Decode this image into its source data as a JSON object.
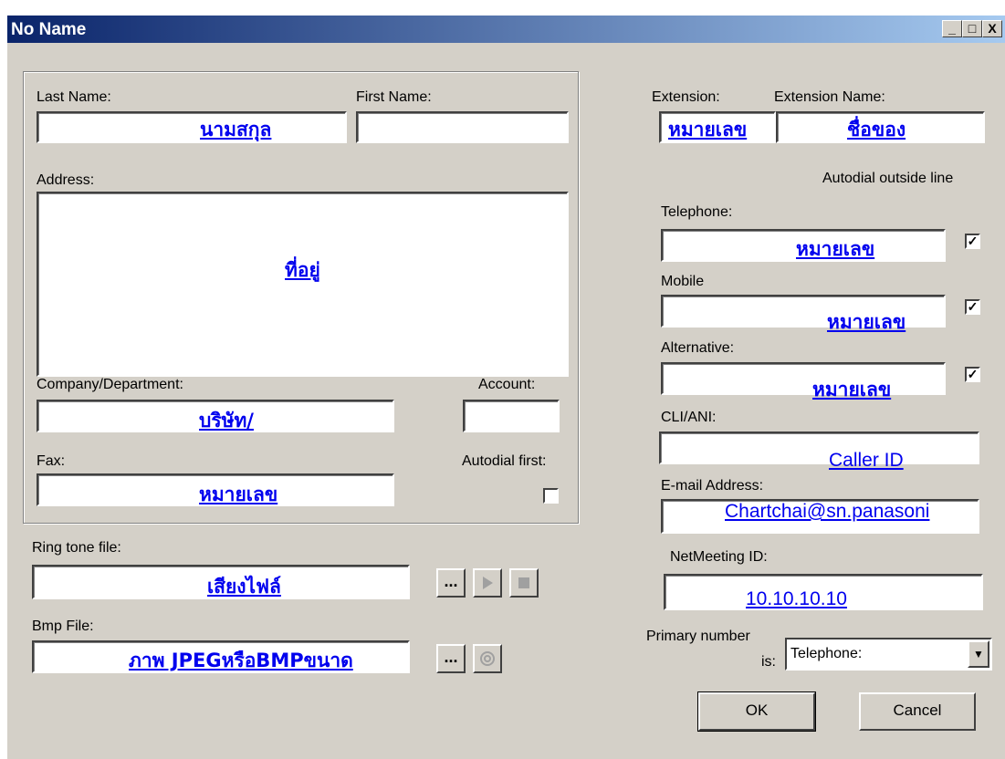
{
  "window": {
    "title": "No Name",
    "minimize": "_",
    "maximize": "□",
    "close": "X"
  },
  "left": {
    "last_name_label": "Last Name:",
    "last_name_value": "นามสกุล",
    "first_name_label": "First Name:",
    "first_name_value": "",
    "address_label": "Address:",
    "address_value": "ที่อยู่",
    "company_label": "Company/Department:",
    "company_value": "บริษัท/",
    "account_label": "Account:",
    "account_value": "",
    "fax_label": "Fax:",
    "fax_value": "หมายเลข",
    "autodial_first_label": "Autodial first:",
    "autodial_first_checked": false
  },
  "bottom_left": {
    "ring_tone_label": "Ring tone file:",
    "ring_tone_value": "เสียงไฟล์",
    "browse_label": "...",
    "bmp_label": "Bmp File:",
    "bmp_value": "ภาพ JPEGหรือBMPขนาด",
    "browse2_label": "..."
  },
  "right": {
    "extension_label": "Extension:",
    "extension_value": "หมายเลข",
    "extension_name_label": "Extension Name:",
    "extension_name_value": "ชื่อของ",
    "autodial_outside_label": "Autodial outside line",
    "telephone_label": "Telephone:",
    "telephone_value": "หมายเลข",
    "telephone_checked": true,
    "mobile_label": "Mobile",
    "mobile_value": "หมายเลข",
    "mobile_checked": true,
    "alternative_label": "Alternative:",
    "alternative_value": "หมายเลข",
    "alternative_checked": true,
    "cli_label": "CLI/ANI:",
    "cli_value": "Caller ID",
    "email_label": "E-mail Address:",
    "email_value": "Chartchai@sn.panasoni",
    "netmeeting_label": "NetMeeting ID:",
    "netmeeting_value": "10.10.10.10",
    "primary_label_line1": "Primary number",
    "primary_label_line2": "is:",
    "primary_value": "Telephone:"
  },
  "buttons": {
    "ok": "OK",
    "cancel": "Cancel"
  },
  "check_mark": "✓",
  "colors": {
    "titlebar_start": "#0a246a",
    "titlebar_end": "#a6caf0",
    "link_blue": "#0000ee",
    "dialog_face": "#d4d0c8"
  }
}
